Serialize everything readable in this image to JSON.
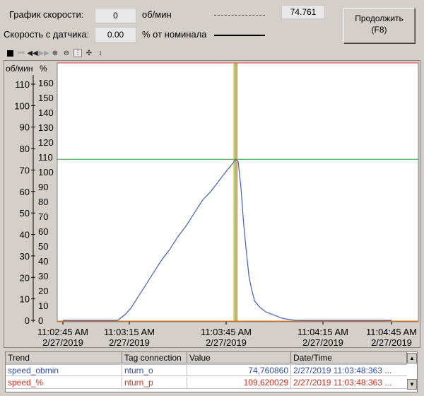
{
  "header": {
    "speed_graph_label": "График скорости:",
    "speed_graph_value": "0",
    "speed_graph_unit": "об/мин",
    "sensor_speed_label": "Скорость с датчика:",
    "sensor_speed_value": "0.00",
    "sensor_speed_unit": "% от номинала",
    "readout_value": "74.761",
    "continue_button": "Продолжить\n(F8)"
  },
  "toolbar": {
    "icons": [
      "stop-icon",
      "first-icon",
      "rewind-icon",
      "forward-icon",
      "zoom-in-icon",
      "zoom-out-icon",
      "ruler-icon",
      "move-icon",
      "scroll-icon"
    ]
  },
  "chart_data": {
    "type": "line",
    "left_axis_unit": "об/мин",
    "right_axis_unit": "%",
    "left_ticks": [
      0,
      10,
      20,
      30,
      40,
      50,
      60,
      70,
      80,
      90,
      100,
      110
    ],
    "right_ticks": [
      0,
      10,
      20,
      30,
      40,
      50,
      60,
      70,
      80,
      90,
      100,
      110,
      120,
      130,
      140,
      150,
      160
    ],
    "ylim_left": [
      0,
      120
    ],
    "x_ticks": [
      {
        "time": "11:02:45 AM",
        "date": "2/27/2019"
      },
      {
        "time": "11:03:15 AM",
        "date": "2/27/2019"
      },
      {
        "time": "11:03:45 AM",
        "date": "2/27/2019"
      },
      {
        "time": "11:04:15 AM",
        "date": "2/27/2019"
      },
      {
        "time": "11:04:45 AM",
        "date": "2/27/2019"
      }
    ],
    "xlim_seconds": [
      0,
      120
    ],
    "ruler_time_seconds": 63,
    "horizontal_ref_obmin": 75,
    "series": [
      {
        "name": "speed_obmin",
        "color": "#4060c0",
        "x": [
          0,
          20,
          21,
          23,
          25,
          27,
          30,
          33,
          36,
          39,
          42,
          45,
          48,
          51,
          54,
          57,
          60,
          62,
          63,
          64,
          65,
          66,
          67,
          68,
          69,
          70,
          72,
          74,
          76,
          78,
          80,
          82,
          85,
          90,
          120
        ],
        "y": [
          0,
          0,
          1,
          3,
          6,
          10,
          16,
          22,
          28,
          33,
          39,
          44,
          50,
          56,
          60,
          65,
          70,
          73,
          75,
          74,
          62,
          45,
          32,
          20,
          14,
          9,
          6,
          4,
          3,
          2,
          1,
          0.5,
          0,
          0,
          0
        ]
      }
    ]
  },
  "table": {
    "columns": [
      "Trend",
      "Tag connection",
      "Value",
      "Date/Time"
    ],
    "rows": [
      {
        "trend": "speed_obmin",
        "tag": "nturn_o",
        "value": "74,760860",
        "datetime": "2/27/2019 11:03:48:363 ...",
        "color": "#3050a0"
      },
      {
        "trend": "speed_%",
        "tag": "nturn_p",
        "value": "109,620029",
        "datetime": "2/27/2019 11:03:48:363 ...",
        "color": "#d03020"
      }
    ]
  },
  "colors": {
    "frame_bg": "#d4d0c8",
    "plot_bg": "#ffffff",
    "grid_line": "#30a030",
    "ruler_orange": "#e07000",
    "ruler_yellow": "#d0c000",
    "top_border_red": "#e04040"
  }
}
